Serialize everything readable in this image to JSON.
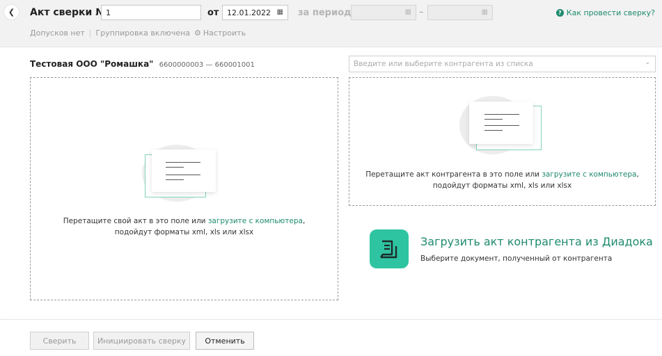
{
  "header": {
    "title": "Акт сверки №",
    "number_value": "1",
    "from_label": "от",
    "date_value": "12.01.2022",
    "period_label": "за период",
    "period_dash": "–",
    "help_link": "Как провести сверку?",
    "sub": {
      "admissions": "Допусков нет",
      "separator": "|",
      "grouping": "Группировка включена",
      "configure": "Настроить"
    }
  },
  "left": {
    "org_name": "Тестовая ООО \"Ромашка\"",
    "org_codes": "6600000003 — 660001001",
    "drop_text_before": "Перетащите свой акт в это поле или ",
    "drop_link": "загрузите с компьютера",
    "drop_text_after": ",",
    "drop_formats": "подойдут форматы xml, xls или xlsx"
  },
  "right": {
    "counterparty_placeholder": "Введите или выберите контрагента из списка",
    "drop_text_before": "Перетащите акт контрагента в это поле или ",
    "drop_link": "загрузите с компьютера",
    "drop_text_after": ",",
    "drop_formats": "подойдут форматы xml, xls или xlsx",
    "diadoc_title": "Загрузить акт контрагента из Диадока",
    "diadoc_subtitle": "Выберите документ, полученный от контрагента"
  },
  "footer": {
    "reconcile_button": "Сверить",
    "initiate_button": "Инициировать сверку",
    "cancel_button": "Отменить"
  },
  "colors": {
    "accent": "#1e8a6e",
    "diadoc_icon": "#2ec4a2",
    "header_bg": "#f2f2f2"
  }
}
